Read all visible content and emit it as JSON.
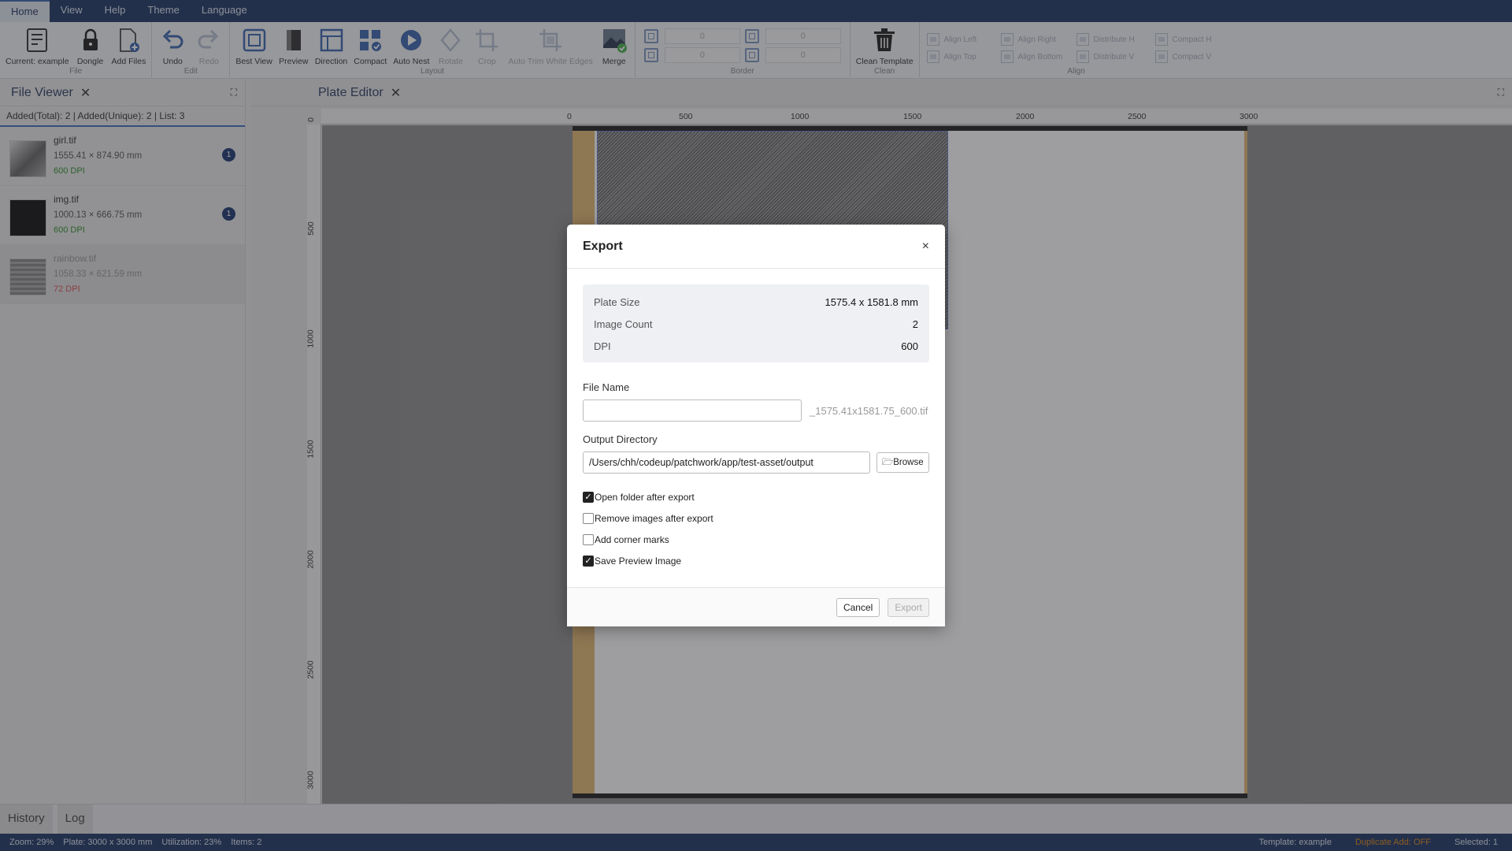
{
  "menubar": {
    "items": [
      "Home",
      "View",
      "Help",
      "Theme",
      "Language"
    ]
  },
  "ribbon": {
    "file": {
      "title": "File",
      "current": "Current: example",
      "dongle": "Dongle",
      "add_files": "Add Files"
    },
    "edit": {
      "title": "Edit",
      "undo": "Undo",
      "redo": "Redo"
    },
    "layout": {
      "title": "Layout",
      "best_view": "Best View",
      "preview": "Preview",
      "direction": "Direction",
      "compact": "Compact",
      "auto_nest": "Auto Nest",
      "rotate": "Rotate",
      "crop": "Crop",
      "auto_trim": "Auto Trim White Edges",
      "merge": "Merge"
    },
    "border": {
      "title": "Border",
      "values": [
        "0",
        "0",
        "0",
        "0"
      ]
    },
    "clean": {
      "title": "Clean",
      "clean_template": "Clean Template"
    },
    "align": {
      "title": "Align",
      "items": [
        "Align Left",
        "Align Right",
        "Distribute H",
        "Compact H",
        "Align Top",
        "Align Bottom",
        "Distribute V",
        "Compact V"
      ]
    }
  },
  "file_viewer": {
    "title": "File Viewer",
    "summary": "Added(Total): 2 | Added(Unique): 2 | List: 3",
    "files": [
      {
        "name": "girl.tif",
        "size": "1555.41 × 874.90 mm",
        "dpi": "600 DPI",
        "count": "1"
      },
      {
        "name": "img.tif",
        "size": "1000.13 × 666.75 mm",
        "dpi": "600 DPI",
        "count": "1"
      },
      {
        "name": "rainbow.tif",
        "size": "1058.33 × 621.59 mm",
        "dpi": "72 DPI"
      }
    ]
  },
  "plate_editor": {
    "title": "Plate Editor",
    "hruler": [
      "0",
      "500",
      "1000",
      "1500",
      "2000",
      "2500",
      "3000"
    ],
    "vruler": [
      "0",
      "500",
      "1000",
      "1500",
      "2000",
      "2500",
      "3000"
    ]
  },
  "bottom_tabs": [
    "History",
    "Log"
  ],
  "status": {
    "zoom": "Zoom: 29%",
    "plate": "Plate: 3000 x 3000 mm",
    "utilization": "Utilization: 23%",
    "items": "Items: 2",
    "template": "Template: example",
    "duplicate": "Duplicate Add: OFF",
    "selected": "Selected: 1"
  },
  "colors": {
    "accent": "#1f3864",
    "ok": "#2d8f2d",
    "warn": "#d9534f",
    "duplicate": "#e08a1e"
  },
  "dialog": {
    "title": "Export",
    "close": "×",
    "info": [
      {
        "k": "Plate Size",
        "v": "1575.4 x 1581.8 mm"
      },
      {
        "k": "Image Count",
        "v": "2"
      },
      {
        "k": "DPI",
        "v": "600"
      }
    ],
    "file_name_label": "File Name",
    "file_name_value": "",
    "file_suffix": "_1575.41x1581.75_600.tif",
    "output_dir_label": "Output Directory",
    "output_dir_value": "/Users/chh/codeup/patchwork/app/test-asset/output",
    "browse": "Browse",
    "options": [
      {
        "label": "Open folder after export",
        "checked": true
      },
      {
        "label": "Remove images after export",
        "checked": false
      },
      {
        "label": "Add corner marks",
        "checked": false
      },
      {
        "label": "Save Preview Image",
        "checked": true
      }
    ],
    "cancel": "Cancel",
    "export": "Export"
  }
}
